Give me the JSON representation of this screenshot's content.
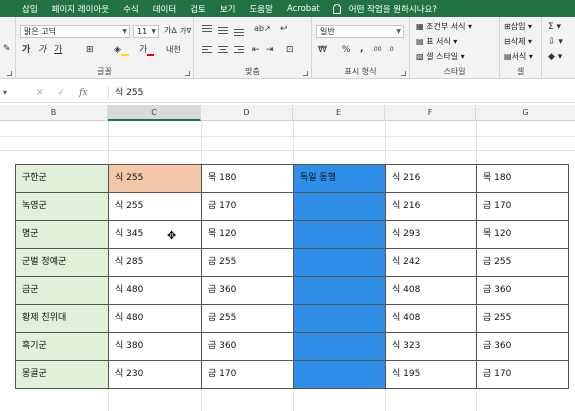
{
  "menu": {
    "tabs": [
      "삽입",
      "페이지 레이아웃",
      "수식",
      "데이터",
      "검토",
      "보기",
      "도움말",
      "Acrobat"
    ],
    "tell_me": "어떤 작업을 원하시나요?"
  },
  "ribbon": {
    "font_name": "맑은 고딕",
    "font_size": "11",
    "font_group_label": "글꼴",
    "align_group_label": "맞춤",
    "number_format": "일반",
    "number_group_label": "표시 형식",
    "cond_format": "조건부 서식",
    "table_format": "표 서식",
    "cell_style": "셀 스타일",
    "style_group_label": "스타일",
    "insert": "삽입",
    "delete": "삭제",
    "format": "서식",
    "cell_group_label": "셀",
    "bold": "가",
    "italic": "가",
    "underline": "가",
    "font_color_glyph": "가",
    "percent": "%",
    "comma": ","
  },
  "formula_bar": {
    "value": "식 255",
    "fx": "fx"
  },
  "columns": [
    "B",
    "C",
    "D",
    "E",
    "F",
    "G"
  ],
  "selected_column": "C",
  "rows": [
    {
      "b": "구한군",
      "c": "식 255",
      "d": "목 180",
      "e": "독일 동행",
      "f": "식 216",
      "g": "목 180"
    },
    {
      "b": "녹영군",
      "c": "식 255",
      "d": "금 170",
      "e": "",
      "f": "식 216",
      "g": "금 170"
    },
    {
      "b": "명군",
      "c": "식 345",
      "d": "목 120",
      "e": "",
      "f": "식 293",
      "g": "목 120"
    },
    {
      "b": "군벌 정예군",
      "c": "식 285",
      "d": "금 255",
      "e": "",
      "f": "식 242",
      "g": "금 255"
    },
    {
      "b": "금군",
      "c": "식 480",
      "d": "금 360",
      "e": "",
      "f": "식 408",
      "g": "금 360"
    },
    {
      "b": "황제 친위대",
      "c": "식 480",
      "d": "금 255",
      "e": "",
      "f": "식 408",
      "g": "금 255"
    },
    {
      "b": "흑기군",
      "c": "식 380",
      "d": "금 360",
      "e": "",
      "f": "식 323",
      "g": "금 360"
    },
    {
      "b": "몽골군",
      "c": "식 230",
      "d": "금 170",
      "e": "",
      "f": "식 195",
      "g": "금 170"
    }
  ],
  "colors": {
    "excel_green": "#217346",
    "label_fill": "#e2efda",
    "highlight_fill": "#f4c7a9",
    "blue_fill": "#2f8fe8"
  }
}
